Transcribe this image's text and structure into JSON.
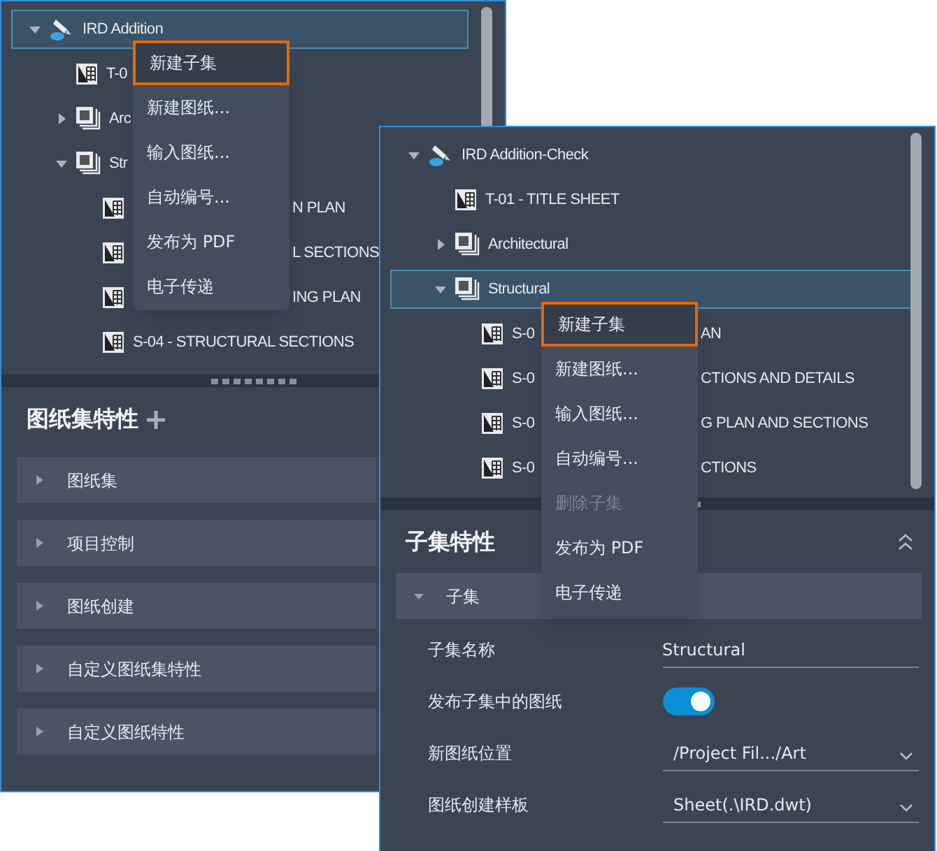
{
  "back_window": {
    "tree": [
      {
        "kind": "sheet_set",
        "label": "IRD Addition",
        "expanded": true,
        "selected": true,
        "children": [
          {
            "kind": "sheet",
            "label": "T-0",
            "selected": false
          },
          {
            "kind": "subset",
            "label": "Arc",
            "expanded": false,
            "selected": false
          },
          {
            "kind": "subset",
            "label": "Str",
            "expanded": true,
            "selected": false,
            "children": [
              {
                "kind": "sheet",
                "tail": "N PLAN",
                "selected": false
              },
              {
                "kind": "sheet",
                "tail": "L SECTIONS",
                "selected": false
              },
              {
                "kind": "sheet",
                "tail": "ING PLAN",
                "selected": false
              },
              {
                "kind": "sheet",
                "label": "S-04 - STRUCTURAL SECTIONS",
                "selected": false
              }
            ]
          }
        ]
      }
    ],
    "menu": [
      {
        "label": "新建子集",
        "selected": true,
        "disabled": false
      },
      {
        "label": "新建图纸...",
        "selected": false,
        "disabled": false
      },
      {
        "label": "输入图纸...",
        "selected": false,
        "disabled": false
      },
      {
        "label": "自动编号...",
        "selected": false,
        "disabled": false
      },
      {
        "label": "发布为 PDF",
        "selected": false,
        "disabled": false
      },
      {
        "label": "电子传递",
        "selected": false,
        "disabled": false
      }
    ],
    "properties": {
      "title": "图纸集特性",
      "sections": [
        {
          "label": "图纸集",
          "expanded": false
        },
        {
          "label": "项目控制",
          "expanded": false
        },
        {
          "label": "图纸创建",
          "expanded": false
        },
        {
          "label": "自定义图纸集特性",
          "expanded": false
        },
        {
          "label": "自定义图纸特性",
          "expanded": false
        }
      ]
    }
  },
  "front_window": {
    "tree": [
      {
        "kind": "sheet_set",
        "label": "IRD Addition-Check",
        "expanded": true,
        "selected": false,
        "children": [
          {
            "kind": "sheet",
            "label": "T-01 - TITLE SHEET",
            "selected": false
          },
          {
            "kind": "subset",
            "label": "Architectural",
            "expanded": false,
            "selected": false
          },
          {
            "kind": "subset",
            "label": "Structural",
            "expanded": true,
            "selected": true,
            "children": [
              {
                "kind": "sheet",
                "label": "S-0",
                "tail": "AN",
                "selected": false
              },
              {
                "kind": "sheet",
                "label": "S-0",
                "tail": "CTIONS AND DETAILS",
                "selected": false
              },
              {
                "kind": "sheet",
                "label": "S-0",
                "tail": "G PLAN AND SECTIONS",
                "selected": false
              },
              {
                "kind": "sheet",
                "label": "S-0",
                "tail": "CTIONS",
                "selected": false
              }
            ]
          }
        ]
      }
    ],
    "menu": [
      {
        "label": "新建子集",
        "selected": true,
        "disabled": false
      },
      {
        "label": "新建图纸...",
        "selected": false,
        "disabled": false
      },
      {
        "label": "输入图纸...",
        "selected": false,
        "disabled": false
      },
      {
        "label": "自动编号...",
        "selected": false,
        "disabled": false
      },
      {
        "label": "删除子集",
        "selected": false,
        "disabled": true
      },
      {
        "label": "发布为 PDF",
        "selected": false,
        "disabled": false
      },
      {
        "label": "电子传递",
        "selected": false,
        "disabled": false
      }
    ],
    "properties": {
      "title": "子集特性",
      "sections": [
        {
          "label": "子集",
          "expanded": true
        }
      ],
      "fields": [
        {
          "kind": "text",
          "label": "子集名称",
          "value": "Structural"
        },
        {
          "kind": "toggle",
          "label": "发布子集中的图纸",
          "on": true
        },
        {
          "kind": "dropdown",
          "label": "新图纸位置",
          "value": "/Project Fil.../Art"
        },
        {
          "kind": "dropdown",
          "label": "图纸创建样板",
          "value": "Sheet(.\\IRD.dwt)"
        }
      ]
    }
  }
}
